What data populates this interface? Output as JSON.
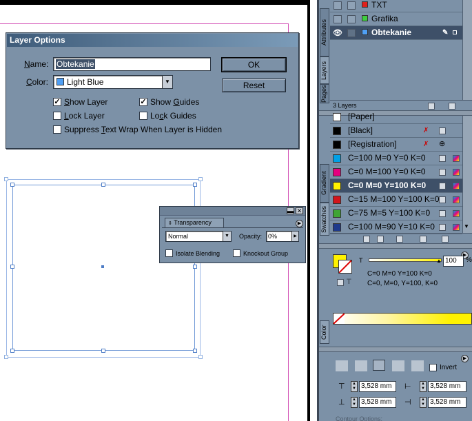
{
  "layer_options": {
    "title": "Layer Options",
    "name_label_pre": "",
    "name_label_u": "N",
    "name_label_post": "ame:",
    "name_value": "Obtekanie",
    "color_label_pre": "",
    "color_label_u": "C",
    "color_label_post": "olor:",
    "color_value": "Light Blue",
    "color_swatch": "#4f9ff4",
    "ok_label": "OK",
    "reset_label": "Reset",
    "show_layer_pre": "",
    "show_layer_u": "S",
    "show_layer_post": "how Layer",
    "show_guides_pre": "Show ",
    "show_guides_u": "G",
    "show_guides_post": "uides",
    "lock_layer_pre": "",
    "lock_layer_u": "L",
    "lock_layer_post": "ock Layer",
    "lock_guides_pre": "Lo",
    "lock_guides_u": "c",
    "lock_guides_post": "k Guides",
    "suppress_pre": "Suppress ",
    "suppress_u": "T",
    "suppress_post": "ext Wrap When Layer is Hidden"
  },
  "transparency": {
    "tab_label": "Transparency",
    "mode_value": "Normal",
    "opacity_label": "Opacity:",
    "opacity_value": "0%",
    "isolate_label": "Isolate Blending",
    "knockout_label": "Knockout Group"
  },
  "layers_panel": {
    "tabs": [
      "Attributes",
      "Layers",
      "Pages"
    ],
    "layers": [
      {
        "name": "TXT",
        "color": "#e0201b"
      },
      {
        "name": "Grafika",
        "color": "#3fce3f"
      },
      {
        "name": "Obtekanie",
        "color": "#4f9ff4"
      }
    ],
    "count_label": "3 Layers"
  },
  "swatches_panel": {
    "tabs": [
      "Gradient",
      "Swatches"
    ],
    "swatches": [
      {
        "name": "[Paper]",
        "color": "#ffffff"
      },
      {
        "name": "[Black]",
        "color": "#000000"
      },
      {
        "name": "[Registration]",
        "color": "#000000"
      },
      {
        "name": "C=100 M=0 Y=0 K=0",
        "color": "#00a0e6"
      },
      {
        "name": "C=0 M=100 Y=0 K=0",
        "color": "#e4007f"
      },
      {
        "name": "C=0 M=0 Y=100 K=0",
        "color": "#fff200"
      },
      {
        "name": "C=15 M=100 Y=100 K=0",
        "color": "#d2141c"
      },
      {
        "name": "C=75 M=5 Y=100 K=0",
        "color": "#3fa535"
      },
      {
        "name": "C=100 M=90 Y=10 K=0",
        "color": "#1e3a8c"
      }
    ]
  },
  "color_panel": {
    "tab_label": "Color",
    "tint_label": "T",
    "tint_value": "100",
    "percent": "%",
    "line1": "C=0 M=0 Y=100 K=0",
    "line2": "C=0, M=0, Y=100, K=0",
    "fill_color": "#fff200"
  },
  "text_wrap_panel": {
    "invert_label": "Invert",
    "top_offset": "3,528 mm",
    "left_offset": "3,528 mm",
    "bottom_offset": "3,528 mm",
    "right_offset": "3,528 mm",
    "contour_label": "Contour Options:"
  }
}
